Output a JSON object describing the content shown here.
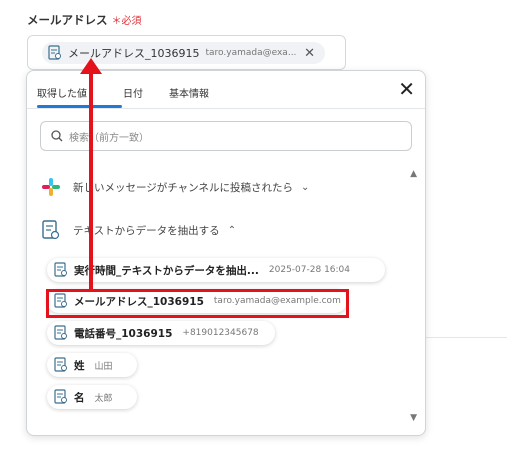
{
  "field": {
    "label": "メールアドレス",
    "required_mark": "＊必須"
  },
  "selected_chip": {
    "name": "メールアドレス_1036915",
    "value": "taro.yamada@exa...",
    "remove_icon": "close-icon"
  },
  "panel": {
    "tabs": [
      {
        "label": "取得した値",
        "active": true
      },
      {
        "label": "日付",
        "active": false
      },
      {
        "label": "基本情報",
        "active": false
      }
    ],
    "close_icon": "close-icon",
    "search_placeholder": "検索（前方一致）",
    "groups": [
      {
        "label": "新しいメッセージがチャンネルに投稿されたら",
        "icon": "slack-icon",
        "expanded": false
      },
      {
        "label": "テキストからデータを抽出する",
        "icon": "document-icon",
        "expanded": true
      }
    ],
    "items": [
      {
        "name": "実行時間_テキストからデータを抽出...",
        "value": "2025-07-28 16:04"
      },
      {
        "name": "メールアドレス_1036915",
        "value": "taro.yamada@example.com",
        "highlighted": true
      },
      {
        "name": "電話番号_1036915",
        "value": "+819012345678"
      },
      {
        "name": "姓",
        "value": "山田"
      },
      {
        "name": "名",
        "value": "太郎"
      }
    ]
  },
  "colors": {
    "accent": "#1f7ad6",
    "annotation": "#e3121b"
  }
}
